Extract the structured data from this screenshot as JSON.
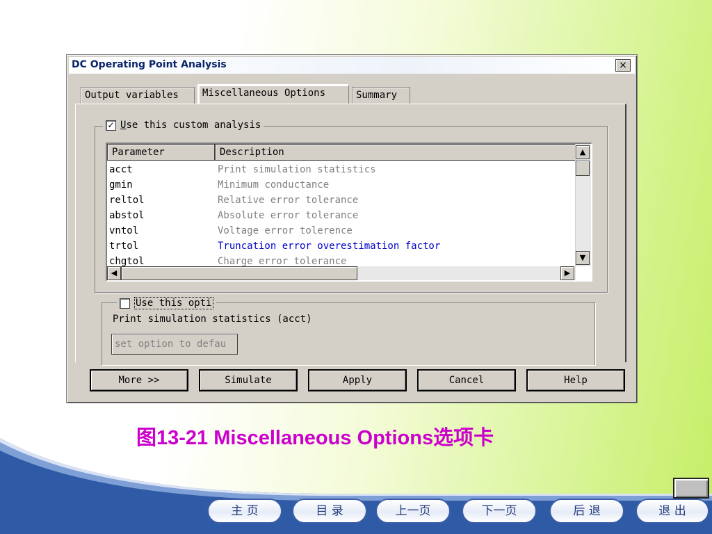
{
  "window": {
    "title": "DC Operating Point Analysis",
    "close_label": "×"
  },
  "tabs": [
    {
      "label": "Output variables"
    },
    {
      "label": "Miscellaneous Options"
    },
    {
      "label": "Summary"
    }
  ],
  "custom_analysis": {
    "label_underlined": "U",
    "label_rest": "se this custom analysis",
    "checked_mark": "✓"
  },
  "table": {
    "headers": [
      "Parameter",
      "Description"
    ],
    "rows": [
      {
        "param": "acct",
        "desc": "Print simulation statistics"
      },
      {
        "param": "gmin",
        "desc": "Minimum conductance"
      },
      {
        "param": "reltol",
        "desc": "Relative error tolerance"
      },
      {
        "param": "abstol",
        "desc": "Absolute error tolerance"
      },
      {
        "param": "vntol",
        "desc": "Voltage error tolerence"
      },
      {
        "param": "trtol",
        "desc": "Truncation error overestimation factor"
      },
      {
        "param": "chgtol",
        "desc": "Charge error tolerance"
      }
    ],
    "scroll_up": "▲",
    "scroll_down": "▼",
    "scroll_left": "◀",
    "scroll_right": "▶"
  },
  "option": {
    "checkbox_label": "Use this opti",
    "description": "Print simulation statistics (acct)",
    "set_default_button": "set option to defau"
  },
  "buttons": {
    "more": "More >>",
    "simulate": "Simulate",
    "apply": "Apply",
    "cancel": "Cancel",
    "help": "Help"
  },
  "caption": "图13-21  Miscellaneous Options选项卡",
  "nav": [
    "主  页",
    "目  录",
    "上一页",
    "下一页",
    "后  退",
    "退  出"
  ]
}
